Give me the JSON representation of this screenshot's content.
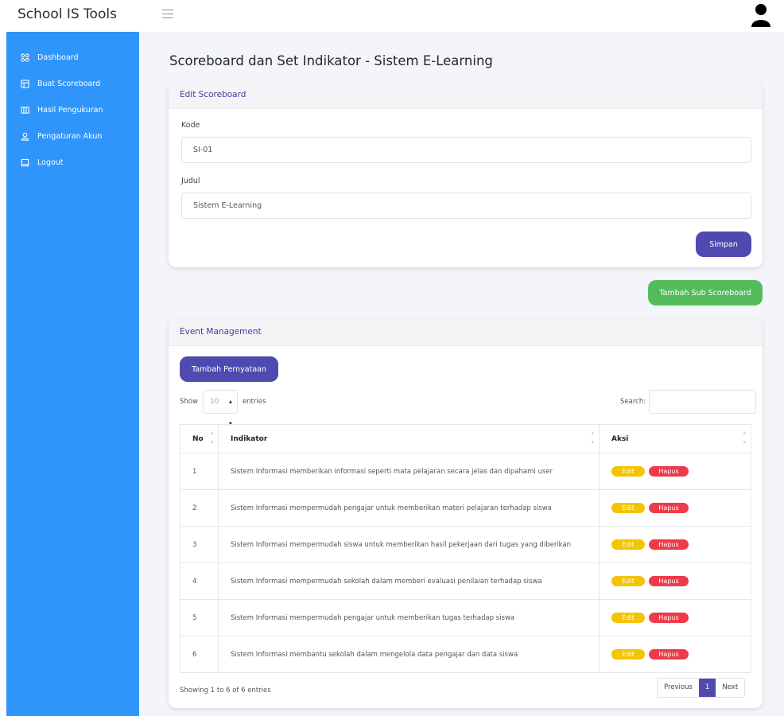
{
  "app": {
    "title": "School IS Tools"
  },
  "sidebar": {
    "items": [
      {
        "label": "Dashboard",
        "icon": "grid-icon"
      },
      {
        "label": "Buat Scoreboard",
        "icon": "layout-icon"
      },
      {
        "label": "Hasil Pengukuran",
        "icon": "columns-icon"
      },
      {
        "label": "Pengaturan Akun",
        "icon": "user-icon"
      },
      {
        "label": "Logout",
        "icon": "square-icon"
      }
    ]
  },
  "page": {
    "title": "Scoreboard dan Set Indikator - Sistem E-Learning"
  },
  "edit_card": {
    "header": "Edit Scoreboard",
    "kode_label": "Kode",
    "kode_value": "SI-01",
    "judul_label": "Judul",
    "judul_value": "Sistem E-Learning",
    "save_label": "Simpan"
  },
  "add_sub_label": "Tambah Sub Scoreboard",
  "event_card": {
    "header": "Event Management",
    "add_label": "Tambah Pernyataan",
    "show_label": "Show",
    "entries_value": "10",
    "entries_label": "entries",
    "search_label": "Search:",
    "columns": [
      "No",
      "Indikator",
      "Aksi"
    ],
    "rows": [
      {
        "no": "1",
        "indikator": "Sistem Informasi memberikan informasi seperti mata pelajaran secara jelas dan dipahami user"
      },
      {
        "no": "2",
        "indikator": "Sistem Informasi mempermudah pengajar untuk memberikan materi pelajaran terhadap siswa"
      },
      {
        "no": "3",
        "indikator": "Sistem Informasi mempermudah siswa untuk memberikan hasil pekerjaan dari tugas yang diberikan"
      },
      {
        "no": "4",
        "indikator": "Sistem Informasi mempermudah sekolah dalam memberi evaluasi penilaian terhadap siswa"
      },
      {
        "no": "5",
        "indikator": "Sistem Informasi mempermudah pengajar untuk memberikan tugas terhadap siswa"
      },
      {
        "no": "6",
        "indikator": "Sistem Informasi membantu sekolah dalam mengelola data pengajar dan data siswa"
      }
    ],
    "edit_label": "Edit",
    "delete_label": "Hapus",
    "info": "Showing 1 to 6 of 6 entries",
    "pager": {
      "prev": "Previous",
      "page": "1",
      "next": "Next"
    }
  },
  "colors": {
    "sidebar": "#2f95fb",
    "primary": "#4e4ab0",
    "success": "#54bb5c",
    "warning": "#f5c400",
    "danger": "#ef3a4a"
  }
}
